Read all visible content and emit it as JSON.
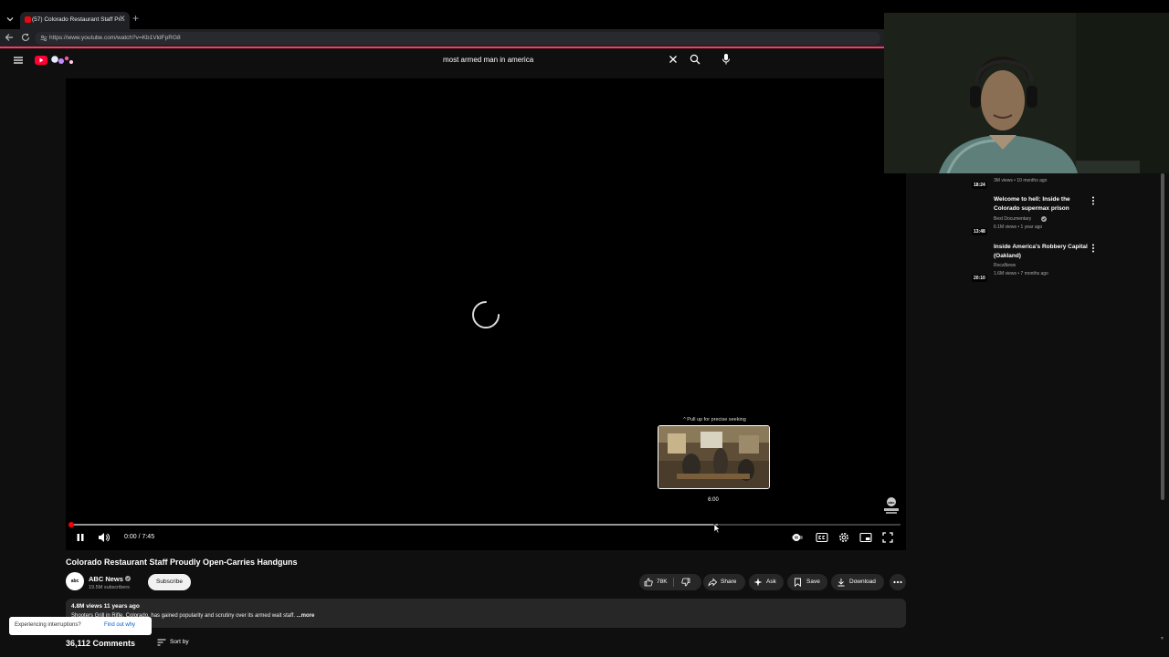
{
  "browser": {
    "tab_title": "(57) Colorado Restaurant Staff Pr...",
    "url": "https://www.youtube.com/watch?v=Kb1VldFpRG8"
  },
  "search": {
    "query": "most armed man in america"
  },
  "player": {
    "seek_hint": "Pull up for precise seeking",
    "preview_time": "6:00",
    "time_display": "0:00 / 7:45",
    "progress_played": 0.0,
    "progress_buffered": 0.78
  },
  "video": {
    "title": "Colorado Restaurant Staff Proudly Open-Carries Handguns",
    "channel": "ABC News",
    "subscribers": "19.5M subscribers",
    "subscribe_label": "Subscribe",
    "likes": "78K",
    "share_label": "Share",
    "ask_label": "Ask",
    "save_label": "Save",
    "download_label": "Download",
    "views_date": "4.8M views  11 years ago",
    "description": "Shooters Grill in Rifle, Colorado, has gained popularity and scrutiny over its armed wait staff.",
    "description_more": " ...more",
    "comments": "36,112 Comments",
    "sort_label": "Sort by"
  },
  "toast": {
    "text": "Experiencing interruptions?",
    "link": "Find out why"
  },
  "related": [
    {
      "duration": "18:24",
      "title": "",
      "channel": "",
      "meta": "3M views • 10 months ago"
    },
    {
      "duration": "13:48",
      "title": "Welcome to hell: Inside the Colorado supermax prison",
      "channel": "Best Documentary",
      "meta": "6.1M views • 1 year ago"
    },
    {
      "duration": "20:10",
      "title": "Inside America's Robbery Capital (Oakland)",
      "channel": "RocaNews",
      "meta": "1.6M views • 7 months ago"
    }
  ],
  "colors": {
    "accent": "#ff0000",
    "background": "#0f0f0f",
    "link": "#065fd4"
  }
}
